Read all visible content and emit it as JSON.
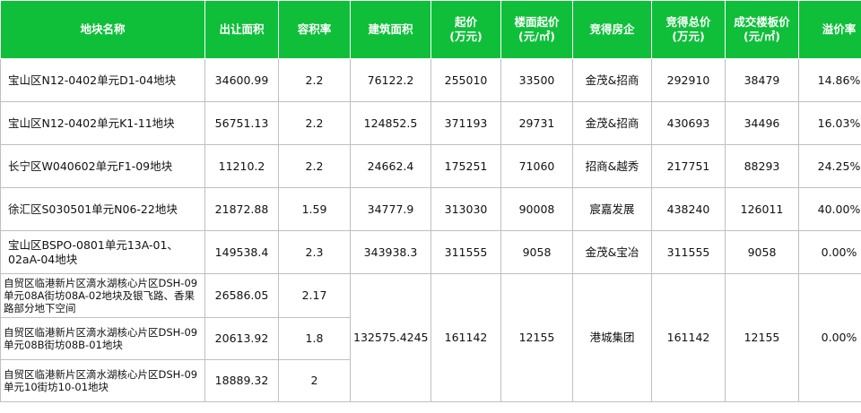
{
  "header": {
    "col0": "地块名称",
    "col1": "出让面积",
    "col2": "容积率",
    "col3": "建筑面积",
    "col4_l1": "起价",
    "col4_l2": "(万元)",
    "col5_l1": "楼面起价",
    "col5_l2": "(元/㎡)",
    "col6": "竞得房企",
    "col7_l1": "竞得总价",
    "col7_l2": "(万元)",
    "col8_l1": "成交楼板价",
    "col8_l2": "(元/㎡)",
    "col9": "溢价率"
  },
  "rows": [
    {
      "name": "宝山区N12-0402单元D1-04地块",
      "area": "34600.99",
      "far": "2.2",
      "building": "76122.2",
      "start": "255010",
      "floor_start": "33500",
      "winner": "金茂&招商",
      "total": "292910",
      "deal_price": "38479",
      "premium": "14.86%"
    },
    {
      "name": "宝山区N12-0402单元K1-11地块",
      "area": "56751.13",
      "far": "2.2",
      "building": "124852.5",
      "start": "371193",
      "floor_start": "29731",
      "winner": "金茂&招商",
      "total": "430693",
      "deal_price": "34496",
      "premium": "16.03%"
    },
    {
      "name": "长宁区W040602单元F1-09地块",
      "area": "11210.2",
      "far": "2.2",
      "building": "24662.4",
      "start": "175251",
      "floor_start": "71060",
      "winner": "招商&越秀",
      "total": "217751",
      "deal_price": "88293",
      "premium": "24.25%"
    },
    {
      "name": "徐汇区S030501单元N06-22地块",
      "area": "21872.88",
      "far": "1.59",
      "building": "34777.9",
      "start": "313030",
      "floor_start": "90008",
      "winner": "宸嘉发展",
      "total": "438240",
      "deal_price": "126011",
      "premium": "40.00%"
    },
    {
      "name": "宝山区BSPO-0801单元13A-01、02aA-04地块",
      "area": "149538.4",
      "far": "2.3",
      "building": "343938.3",
      "start": "311555",
      "floor_start": "9058",
      "winner": "金茂&宝冶",
      "total": "311555",
      "deal_price": "9058",
      "premium": "0.00%"
    }
  ],
  "merged": {
    "parcels": [
      {
        "name": "自贸区临港新片区滴水湖核心片区DSH-09单元08A街坊08A-02地块及银飞路、香果路部分地下空间",
        "area": "26586.05",
        "far": "2.17"
      },
      {
        "name": "自贸区临港新片区滴水湖核心片区DSH-09单元08B街坊08B-01地块",
        "area": "20613.92",
        "far": "1.8"
      },
      {
        "name": "自贸区临港新片区滴水湖核心片区DSH-09单元10街坊10-01地块",
        "area": "18889.32",
        "far": "2"
      }
    ],
    "building": "132575.4245",
    "start": "161142",
    "floor_start": "12155",
    "winner": "港城集团",
    "total": "161142",
    "deal_price": "12155",
    "premium": "0.00%"
  }
}
